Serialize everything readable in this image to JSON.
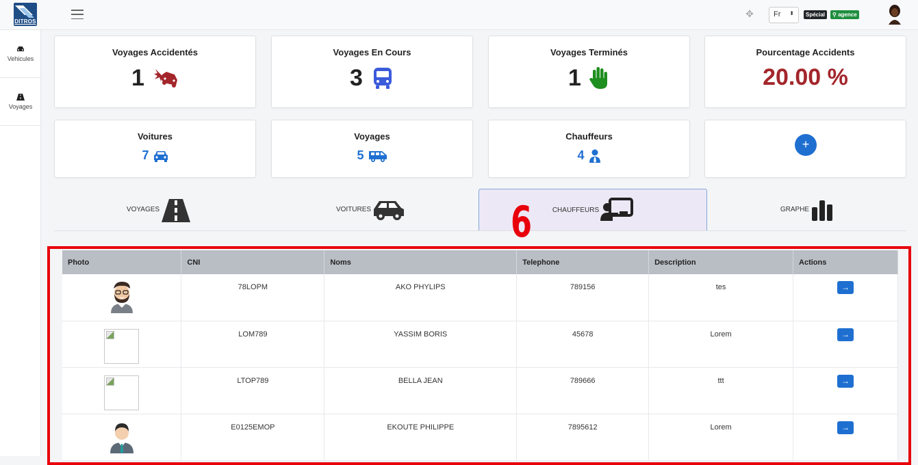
{
  "header": {
    "logo_text": "DITROS",
    "language": "Fr",
    "badge_special": "Spécial",
    "badge_agence": "agence"
  },
  "sidebar": {
    "items": [
      {
        "label": "Vehicules",
        "icon": "car-icon"
      },
      {
        "label": "Voyages",
        "icon": "road-icon"
      }
    ]
  },
  "stats_row1": [
    {
      "title": "Voyages Accidentés",
      "value": "1",
      "icon": "car-crash-icon",
      "color": "#a3262b"
    },
    {
      "title": "Voyages En Cours",
      "value": "3",
      "icon": "bus-icon",
      "color": "#3b5bdb"
    },
    {
      "title": "Voyages Terminés",
      "value": "1",
      "icon": "hand-icon",
      "color": "#1e8e1e"
    },
    {
      "title": "Pourcentage Accidents",
      "value": "20.00 %",
      "color": "#a3262b"
    }
  ],
  "stats_row2": [
    {
      "title": "Voitures",
      "value": "7",
      "icon": "car-icon"
    },
    {
      "title": "Voyages",
      "value": "5",
      "icon": "shuttle-van-icon"
    },
    {
      "title": "Chauffeurs",
      "value": "4",
      "icon": "user-tie-icon"
    }
  ],
  "add_button": "+",
  "tabs": [
    {
      "label": "VOYAGES",
      "icon": "road-icon",
      "active": false
    },
    {
      "label": "VOITURES",
      "icon": "car-side-icon",
      "active": false
    },
    {
      "label": "CHAUFFEURS",
      "icon": "chalkboard-teacher-icon",
      "active": true
    },
    {
      "label": "GRAPHE",
      "icon": "bar-chart-icon",
      "active": false
    }
  ],
  "annotation_marker": "6",
  "table": {
    "columns": [
      "Photo",
      "CNI",
      "Noms",
      "Telephone",
      "Description",
      "Actions"
    ],
    "rows": [
      {
        "photo": "bearded-man-avatar",
        "cni": "78LOPM",
        "nom": "AKO PHYLIPS",
        "telephone": "789156",
        "description": "tes"
      },
      {
        "photo": "broken-image",
        "cni": "LOM789",
        "nom": "YASSIM BORIS",
        "telephone": "45678",
        "description": "Lorem"
      },
      {
        "photo": "broken-image",
        "cni": "LTOP789",
        "nom": "BELLA JEAN",
        "telephone": "789666",
        "description": "ttt"
      },
      {
        "photo": "businessman-avatar",
        "cni": "E0125EMOP",
        "nom": "EKOUTE PHILIPPE",
        "telephone": "7895612",
        "description": "Lorem"
      }
    ],
    "action_icon": "arrow-right-icon",
    "action_symbol": "→"
  }
}
